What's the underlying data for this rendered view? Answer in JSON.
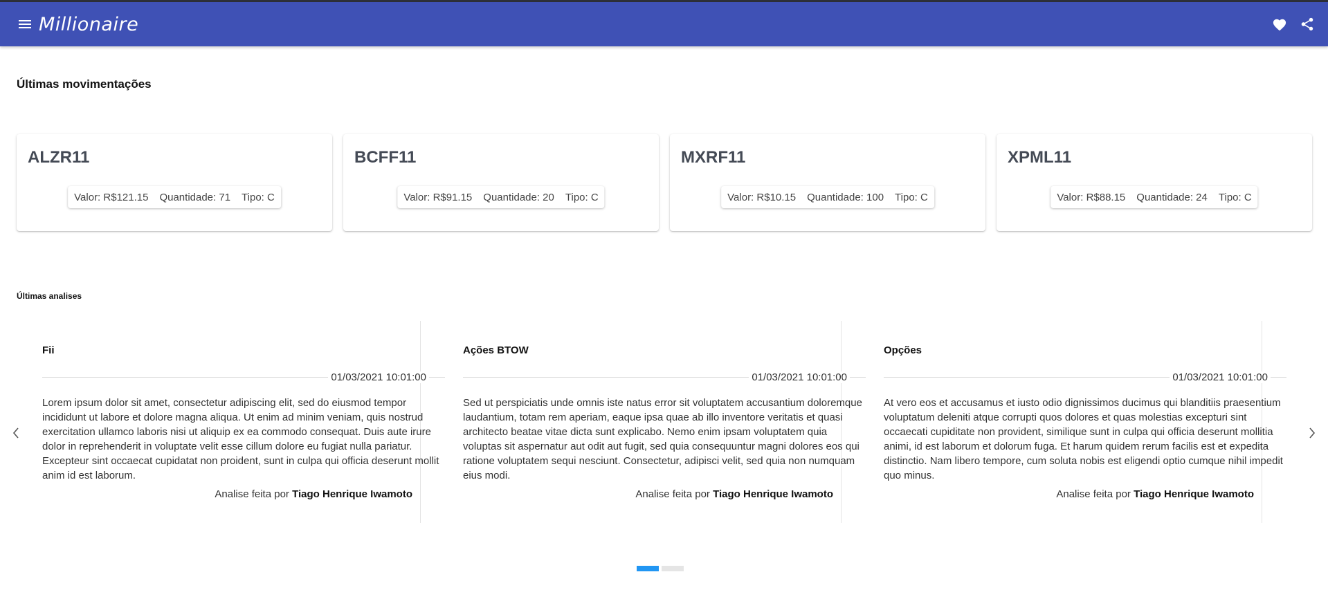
{
  "app": {
    "title": "Millionaire",
    "menu_icon": "menu-icon",
    "favorite_icon": "heart-icon",
    "share_icon": "share-icon",
    "bar_color": "#3f51b5"
  },
  "movimentacoes": {
    "title": "Últimas movimentações",
    "cards": [
      {
        "name": "ALZR11",
        "valor": "Valor: R$121.15",
        "quantidade": "Quantidade: 71",
        "tipo": "Tipo: C"
      },
      {
        "name": "BCFF11",
        "valor": "Valor: R$91.15",
        "quantidade": "Quantidade: 20",
        "tipo": "Tipo: C"
      },
      {
        "name": "MXRF11",
        "valor": "Valor: R$10.15",
        "quantidade": "Quantidade: 100",
        "tipo": "Tipo: C"
      },
      {
        "name": "XPML11",
        "valor": "Valor: R$88.15",
        "quantidade": "Quantidade: 24",
        "tipo": "Tipo: C"
      }
    ]
  },
  "analises": {
    "title": "Últimas analises",
    "author_prefix": "Analise feita por",
    "slides": [
      {
        "title": "Fii",
        "date": "01/03/2021 10:01:00",
        "text": "Lorem ipsum dolor sit amet, consectetur adipiscing elit, sed do eiusmod tempor incididunt ut labore et dolore magna aliqua. Ut enim ad minim veniam, quis nostrud exercitation ullamco laboris nisi ut aliquip ex ea commodo consequat. Duis aute irure dolor in reprehenderit in voluptate velit esse cillum dolore eu fugiat nulla pariatur. Excepteur sint occaecat cupidatat non proident, sunt in culpa qui officia deserunt mollit anim id est laborum.",
        "author": "Tiago Henrique Iwamoto"
      },
      {
        "title": "Ações BTOW",
        "date": "01/03/2021 10:01:00",
        "text": "Sed ut perspiciatis unde omnis iste natus error sit voluptatem accusantium doloremque laudantium, totam rem aperiam, eaque ipsa quae ab illo inventore veritatis et quasi architecto beatae vitae dicta sunt explicabo. Nemo enim ipsam voluptatem quia voluptas sit aspernatur aut odit aut fugit, sed quia consequuntur magni dolores eos qui ratione voluptatem sequi nesciunt. Consectetur, adipisci velit, sed quia non numquam eius modi.",
        "author": "Tiago Henrique Iwamoto"
      },
      {
        "title": "Opções",
        "date": "01/03/2021 10:01:00",
        "text": "At vero eos et accusamus et iusto odio dignissimos ducimus qui blanditiis praesentium voluptatum deleniti atque corrupti quos dolores et quas molestias excepturi sint occaecati cupiditate non provident, similique sunt in culpa qui officia deserunt mollitia animi, id est laborum et dolorum fuga. Et harum quidem rerum facilis est et expedita distinctio. Nam libero tempore, cum soluta nobis est eligendi optio cumque nihil impedit quo minus.",
        "author": "Tiago Henrique Iwamoto"
      }
    ],
    "prev_icon": "chevron-left-icon",
    "next_icon": "chevron-right-icon",
    "page_count": 2,
    "active_page": 1
  }
}
